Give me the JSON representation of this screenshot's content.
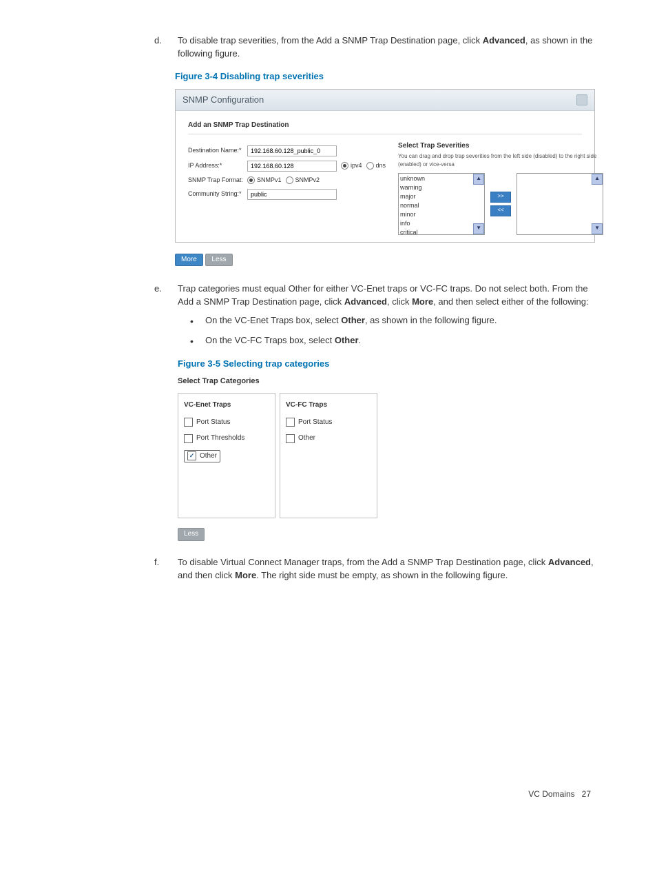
{
  "step_d": {
    "marker": "d.",
    "text_before": "To disable trap severities, from the Add a SNMP Trap Destination page, click ",
    "advanced": "Advanced",
    "text_after": ", as shown in the following figure."
  },
  "fig34": {
    "caption": "Figure 3-4 Disabling trap severities",
    "panel_title": "SNMP Configuration",
    "sub_title": "Add an SNMP Trap Destination",
    "labels": {
      "dest": "Destination Name:*",
      "ip": "IP Address:*",
      "fmt": "SNMP Trap Format:",
      "comm": "Community String:*"
    },
    "values": {
      "dest": "192.168.60.128_public_0",
      "ip": "192.168.60.128",
      "comm": "public"
    },
    "radios": {
      "ipv4": "ipv4",
      "dns": "dns",
      "snmpv1": "SNMPv1",
      "snmpv2": "SNMPv2"
    },
    "sev": {
      "title": "Select Trap Severities",
      "hint": "You can drag and drop trap severities from the left side (disabled) to the right side (enabled) or vice-versa",
      "items": [
        "unknown",
        "warning",
        "major",
        "normal",
        "minor",
        "info",
        "critical"
      ],
      "btn_r": ">>",
      "btn_l": "<<"
    },
    "more": "More",
    "less": "Less"
  },
  "step_e": {
    "marker": "e.",
    "p1a": "Trap categories must equal Other for either VC-Enet traps or VC-FC traps. Do not select both. From the Add a SNMP Trap Destination page, click ",
    "adv": "Advanced",
    "p1b": ", click ",
    "more": "More",
    "p1c": ", and then select either of the following:",
    "b1a": "On the VC-Enet Traps box, select ",
    "b_other": "Other",
    "b1b": ", as shown in the following figure.",
    "b2a": "On the VC-FC Traps box, select ",
    "b2b": "."
  },
  "fig35": {
    "caption": "Figure 3-5 Selecting trap categories",
    "title": "Select Trap Categories",
    "enet": {
      "head": "VC-Enet Traps",
      "opts": [
        "Port Status",
        "Port Thresholds",
        "Other"
      ]
    },
    "fc": {
      "head": "VC-FC Traps",
      "opts": [
        "Port Status",
        "Other"
      ]
    },
    "less": "Less"
  },
  "step_f": {
    "marker": "f.",
    "a": "To disable Virtual Connect Manager traps, from the Add a SNMP Trap Destination page, click ",
    "adv": "Advanced",
    "b": ", and then click ",
    "more": "More",
    "c": ". The right side must be empty, as shown in the following figure."
  },
  "footer": {
    "label": "VC Domains",
    "page": "27"
  }
}
